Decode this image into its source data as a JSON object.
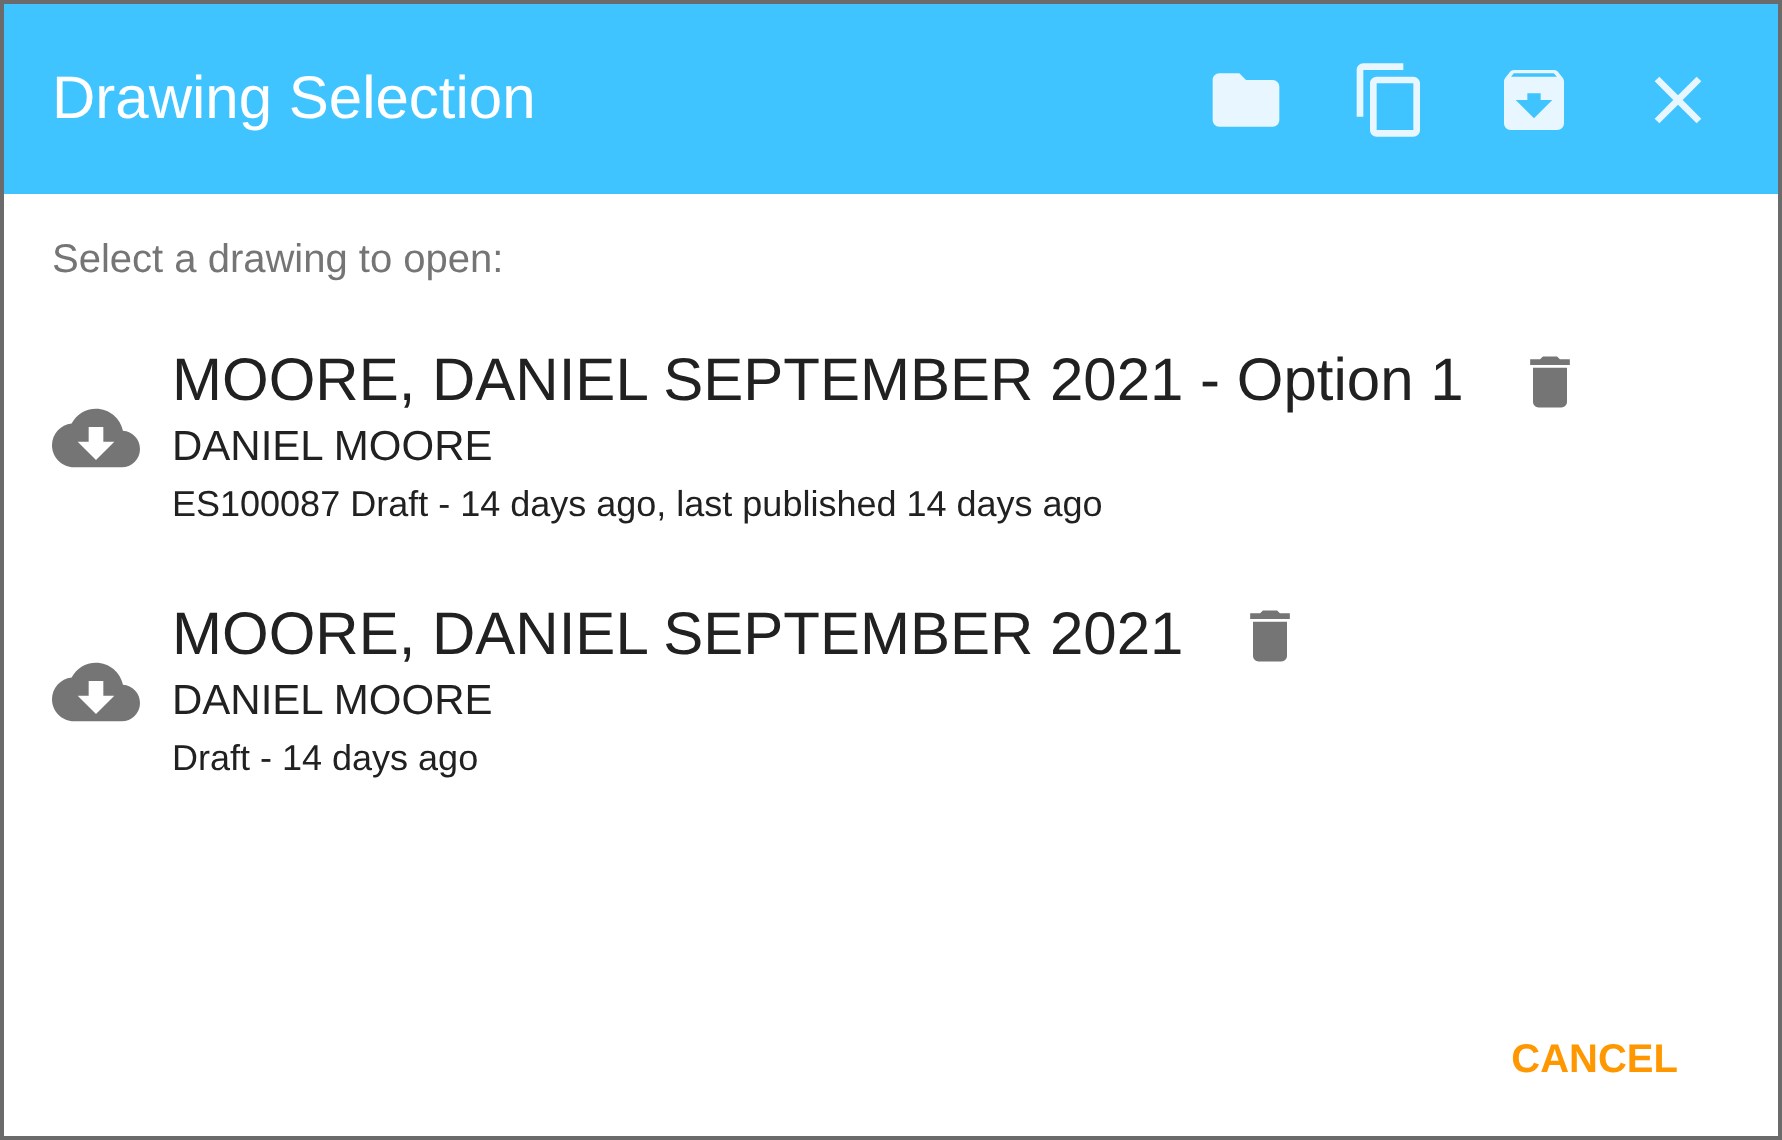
{
  "dialog": {
    "title": "Drawing Selection"
  },
  "prompt": "Select a drawing to open:",
  "drawings": [
    {
      "title": "MOORE, DANIEL SEPTEMBER 2021 - Option 1",
      "owner": "DANIEL MOORE",
      "status": "ES100087 Draft - 14 days ago, last published 14 days ago"
    },
    {
      "title": "MOORE, DANIEL SEPTEMBER 2021",
      "owner": "DANIEL MOORE",
      "status": "Draft - 14 days ago"
    }
  ],
  "buttons": [
    {
      "label": "CANCEL"
    }
  ]
}
